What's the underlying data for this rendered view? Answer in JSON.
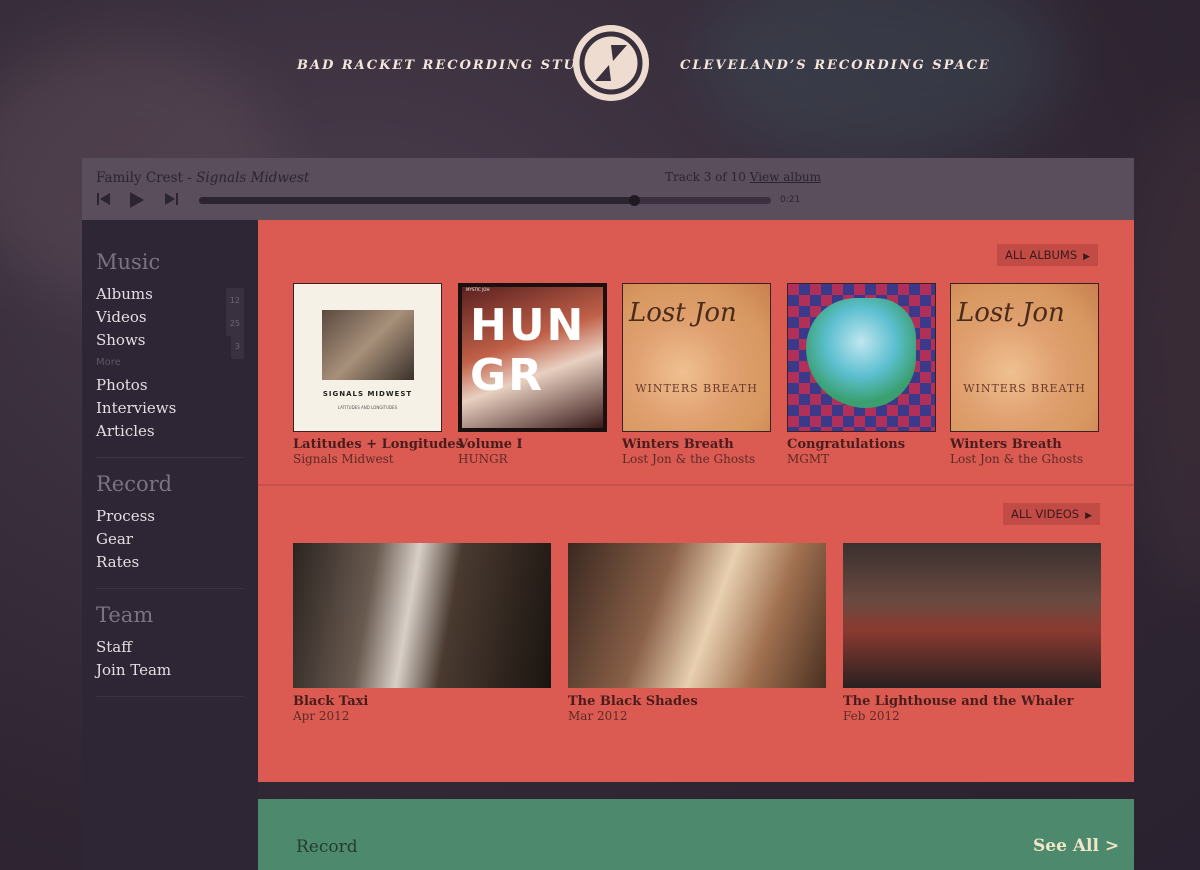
{
  "header": {
    "brand_left": "BAD RACKET RECORDING STUDIO",
    "brand_right": "CLEVELAND’S RECORDING SPACE",
    "logo_icon": "bad-racket-logo"
  },
  "player": {
    "artist": "Family Crest",
    "separator": " - ",
    "song": "Signals Midwest",
    "track_text": "Track 3 of 10",
    "view_album": "View album",
    "time": "0:21",
    "progress": 0.76
  },
  "sidebar": {
    "music": {
      "title": "Music",
      "items": [
        {
          "label": "Albums",
          "badge": "12"
        },
        {
          "label": "Videos",
          "badge": "25"
        },
        {
          "label": "Shows",
          "badge": "3"
        }
      ],
      "more": "More",
      "more_items": [
        "Photos",
        "Interviews",
        "Articles"
      ]
    },
    "record": {
      "title": "Record",
      "items": [
        "Process",
        "Gear",
        "Rates"
      ]
    },
    "team": {
      "title": "Team",
      "items": [
        "Staff",
        "Join Team"
      ]
    }
  },
  "albums": {
    "all_label": "ALL ALBUMS",
    "items": [
      {
        "title": "Latitudes + Longitudes",
        "artist": "Signals Midwest",
        "cover_text": "SIGNALS MIDWEST",
        "cover_sub": "LATITUDES AND LONGITUDES"
      },
      {
        "title": "Volume I",
        "artist": "HUNGR",
        "cover_text": "HUN GR",
        "cover_top": "MYSTIC JOH"
      },
      {
        "title": "Winters Breath",
        "artist": "Lost Jon & the Ghosts",
        "cover_text": "Lost Jon",
        "cover_sub": "WINTERS BREATH"
      },
      {
        "title": "Congratulations",
        "artist": "MGMT"
      },
      {
        "title": "Winters Breath",
        "artist": "Lost Jon & the Ghosts",
        "cover_text": "Lost Jon",
        "cover_sub": "WINTERS BREATH"
      }
    ]
  },
  "videos": {
    "all_label": "ALL VIDEOS",
    "items": [
      {
        "title": "Black Taxi",
        "date": "Apr 2012"
      },
      {
        "title": "The Black Shades",
        "date": "Mar 2012"
      },
      {
        "title": "The Lighthouse and the Whaler",
        "date": "Feb 2012"
      }
    ]
  },
  "record_section": {
    "title": "Record",
    "see_all": "See All >"
  },
  "colors": {
    "red_panel": "#db5b52",
    "green_panel": "#4d8a6d",
    "sidebar": "#2e2634",
    "player": "#5a4d5c"
  }
}
